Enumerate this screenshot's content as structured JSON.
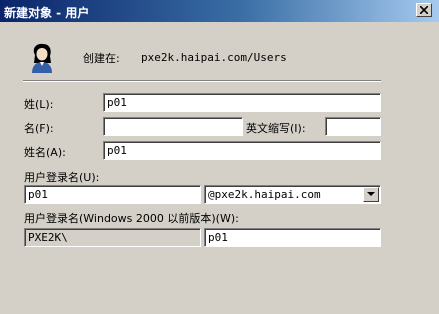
{
  "window": {
    "title": "新建对象 - 用户"
  },
  "header": {
    "created_in_label": "创建在:",
    "created_in_path": "pxe2k.haipai.com/Users"
  },
  "form": {
    "last_name_label": "姓(L):",
    "last_name_value": "p01",
    "first_name_label": "名(F):",
    "first_name_value": "",
    "initials_label": "英文缩写(I):",
    "initials_value": "",
    "full_name_label": "姓名(A):",
    "full_name_value": "p01",
    "logon_name_label": "用户登录名(U):",
    "logon_name_value": "p01",
    "domain_suffix_value": "@pxe2k.haipai.com",
    "pre2000_label": "用户登录名(Windows 2000 以前版本)(W):",
    "pre2000_domain_value": "PXE2K\\",
    "pre2000_name_value": "p01"
  }
}
